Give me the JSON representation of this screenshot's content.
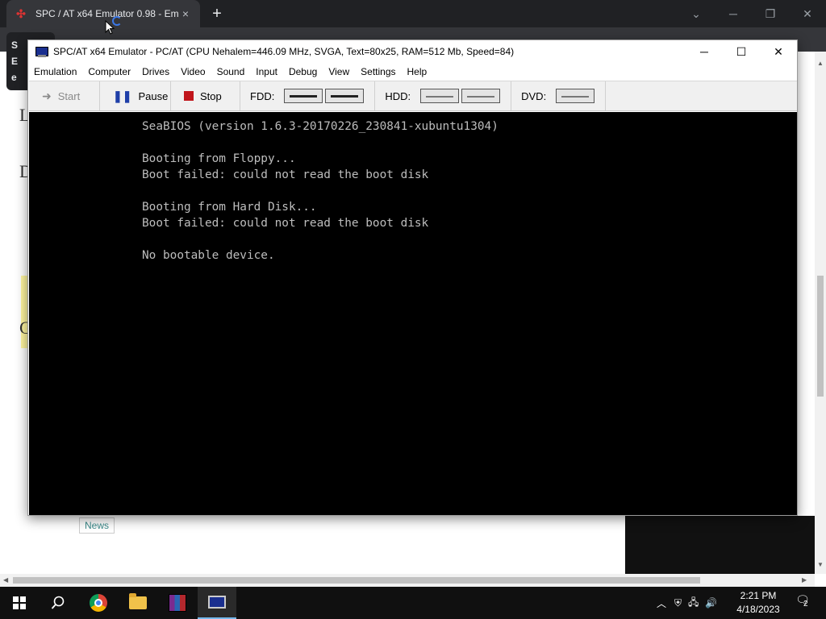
{
  "browser": {
    "tab_title": "SPC / AT x64 Emulator 0.98 - Em",
    "tab_close": "×",
    "new_tab": "+",
    "window_controls": {
      "minimize": "─",
      "restore": "❐",
      "close": "✕",
      "tabs_menu": "⌄"
    }
  },
  "page": {
    "popup_text": "S\nE\ne",
    "letters": [
      "L",
      "D",
      "G"
    ],
    "news_link": "News"
  },
  "emulator": {
    "title": "SPC/AT x64 Emulator - PC/AT (CPU Nehalem=446.09 MHz, SVGA, Text=80x25, RAM=512 Mb, Speed=84)",
    "window_buttons": {
      "minimize": "─",
      "maximize": "☐",
      "close": "✕"
    },
    "menu": [
      "Emulation",
      "Computer",
      "Drives",
      "Video",
      "Sound",
      "Input",
      "Debug",
      "View",
      "Settings",
      "Help"
    ],
    "toolbar": {
      "start": "Start",
      "pause": "Pause",
      "stop": "Stop",
      "fdd_label": "FDD:",
      "hdd_label": "HDD:",
      "dvd_label": "DVD:"
    },
    "screen_text": "SeaBIOS (version 1.6.3-20170226_230841-xubuntu1304)\n\nBooting from Floppy...\nBoot failed: could not read the boot disk\n\nBooting from Hard Disk...\nBoot failed: could not read the boot disk\n\nNo bootable device."
  },
  "taskbar": {
    "time": "2:21 PM",
    "date": "4/18/2023",
    "notification_count": "2",
    "apps": [
      "windows-start",
      "search",
      "chrome",
      "file-explorer",
      "winrar",
      "spc-at-emulator"
    ]
  },
  "colors": {
    "chrome_dark": "#202124",
    "screen_bg": "#000000",
    "screen_text": "#bdbdbd",
    "stop_red": "#c0151b",
    "pause_blue": "#1f3fa8",
    "taskbar": "#101010"
  }
}
